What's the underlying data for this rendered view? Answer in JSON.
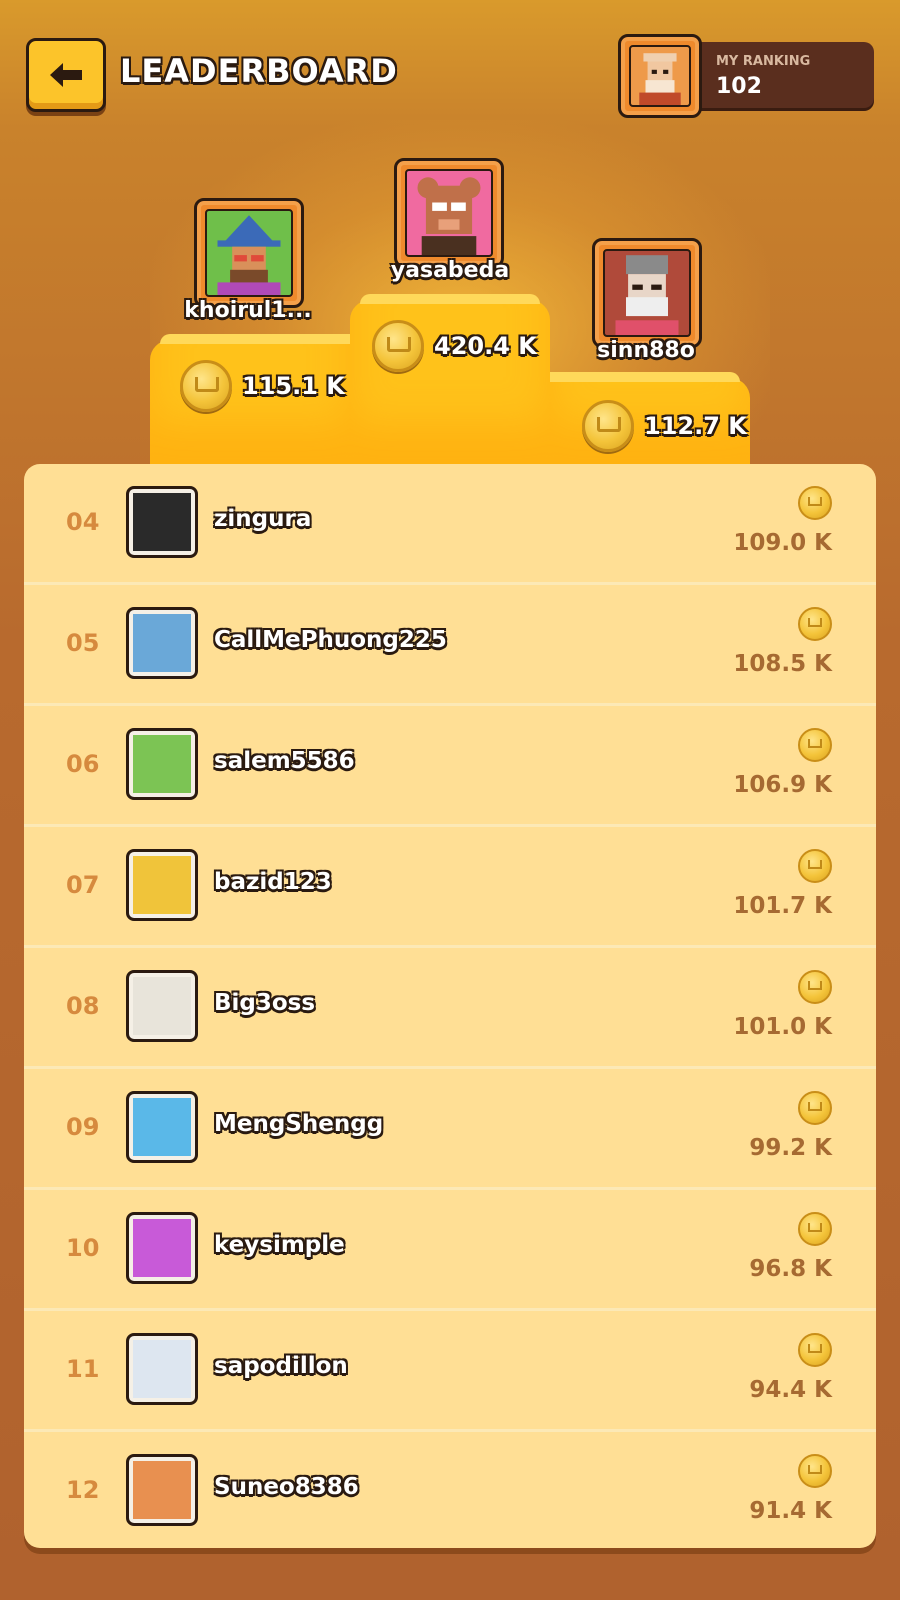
{
  "header": {
    "title": "LEADERBOARD",
    "my_ranking_label": "MY RANKING",
    "my_ranking_value": "102"
  },
  "podium": {
    "first": {
      "name": "yasabeda",
      "score": "420.4 K",
      "avatar_color": "#f06aa0"
    },
    "second": {
      "name": "khoirul1...",
      "score": "115.1 K",
      "avatar_color": "#6fbf4a"
    },
    "third": {
      "name": "sinn88o",
      "score": "112.7 K",
      "avatar_color": "#b04a3a"
    }
  },
  "rows": [
    {
      "rank": "04",
      "name": "zingura",
      "score": "109.0 K",
      "avatar_color": "#2a2a2a"
    },
    {
      "rank": "05",
      "name": "CallMePhuong225",
      "score": "108.5 K",
      "avatar_color": "#6aa8d8"
    },
    {
      "rank": "06",
      "name": "salem5586",
      "score": "106.9 K",
      "avatar_color": "#7cc454"
    },
    {
      "rank": "07",
      "name": "bazid123",
      "score": "101.7 K",
      "avatar_color": "#f0c43a"
    },
    {
      "rank": "08",
      "name": "Big3oss",
      "score": "101.0 K",
      "avatar_color": "#e8e4da"
    },
    {
      "rank": "09",
      "name": "MengShengg",
      "score": "99.2 K",
      "avatar_color": "#5ab8e8"
    },
    {
      "rank": "10",
      "name": "keysimple",
      "score": "96.8 K",
      "avatar_color": "#c85ad8"
    },
    {
      "rank": "11",
      "name": "sapodillon",
      "score": "94.4 K",
      "avatar_color": "#dde6f0"
    },
    {
      "rank": "12",
      "name": "Suneo8386",
      "score": "91.4 K",
      "avatar_color": "#e89050"
    }
  ]
}
